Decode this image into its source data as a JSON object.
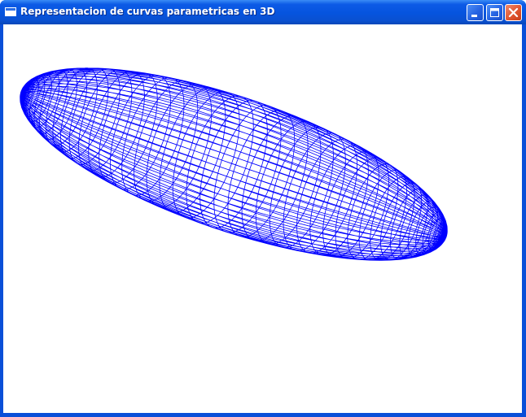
{
  "window": {
    "title": "Representacion de curvas parametricas en 3D",
    "controls": {
      "minimize_icon": "minimize-icon",
      "maximize_icon": "maximize-icon",
      "close_icon": "close-icon"
    }
  },
  "colors": {
    "titlebar": "#0a50d8",
    "client_background": "#ffffff",
    "wireframe": "#0000ff",
    "close_button": "#e0552f"
  },
  "canvas": {
    "content": "wireframe parametric surface (elongated ellipsoid mesh)"
  }
}
